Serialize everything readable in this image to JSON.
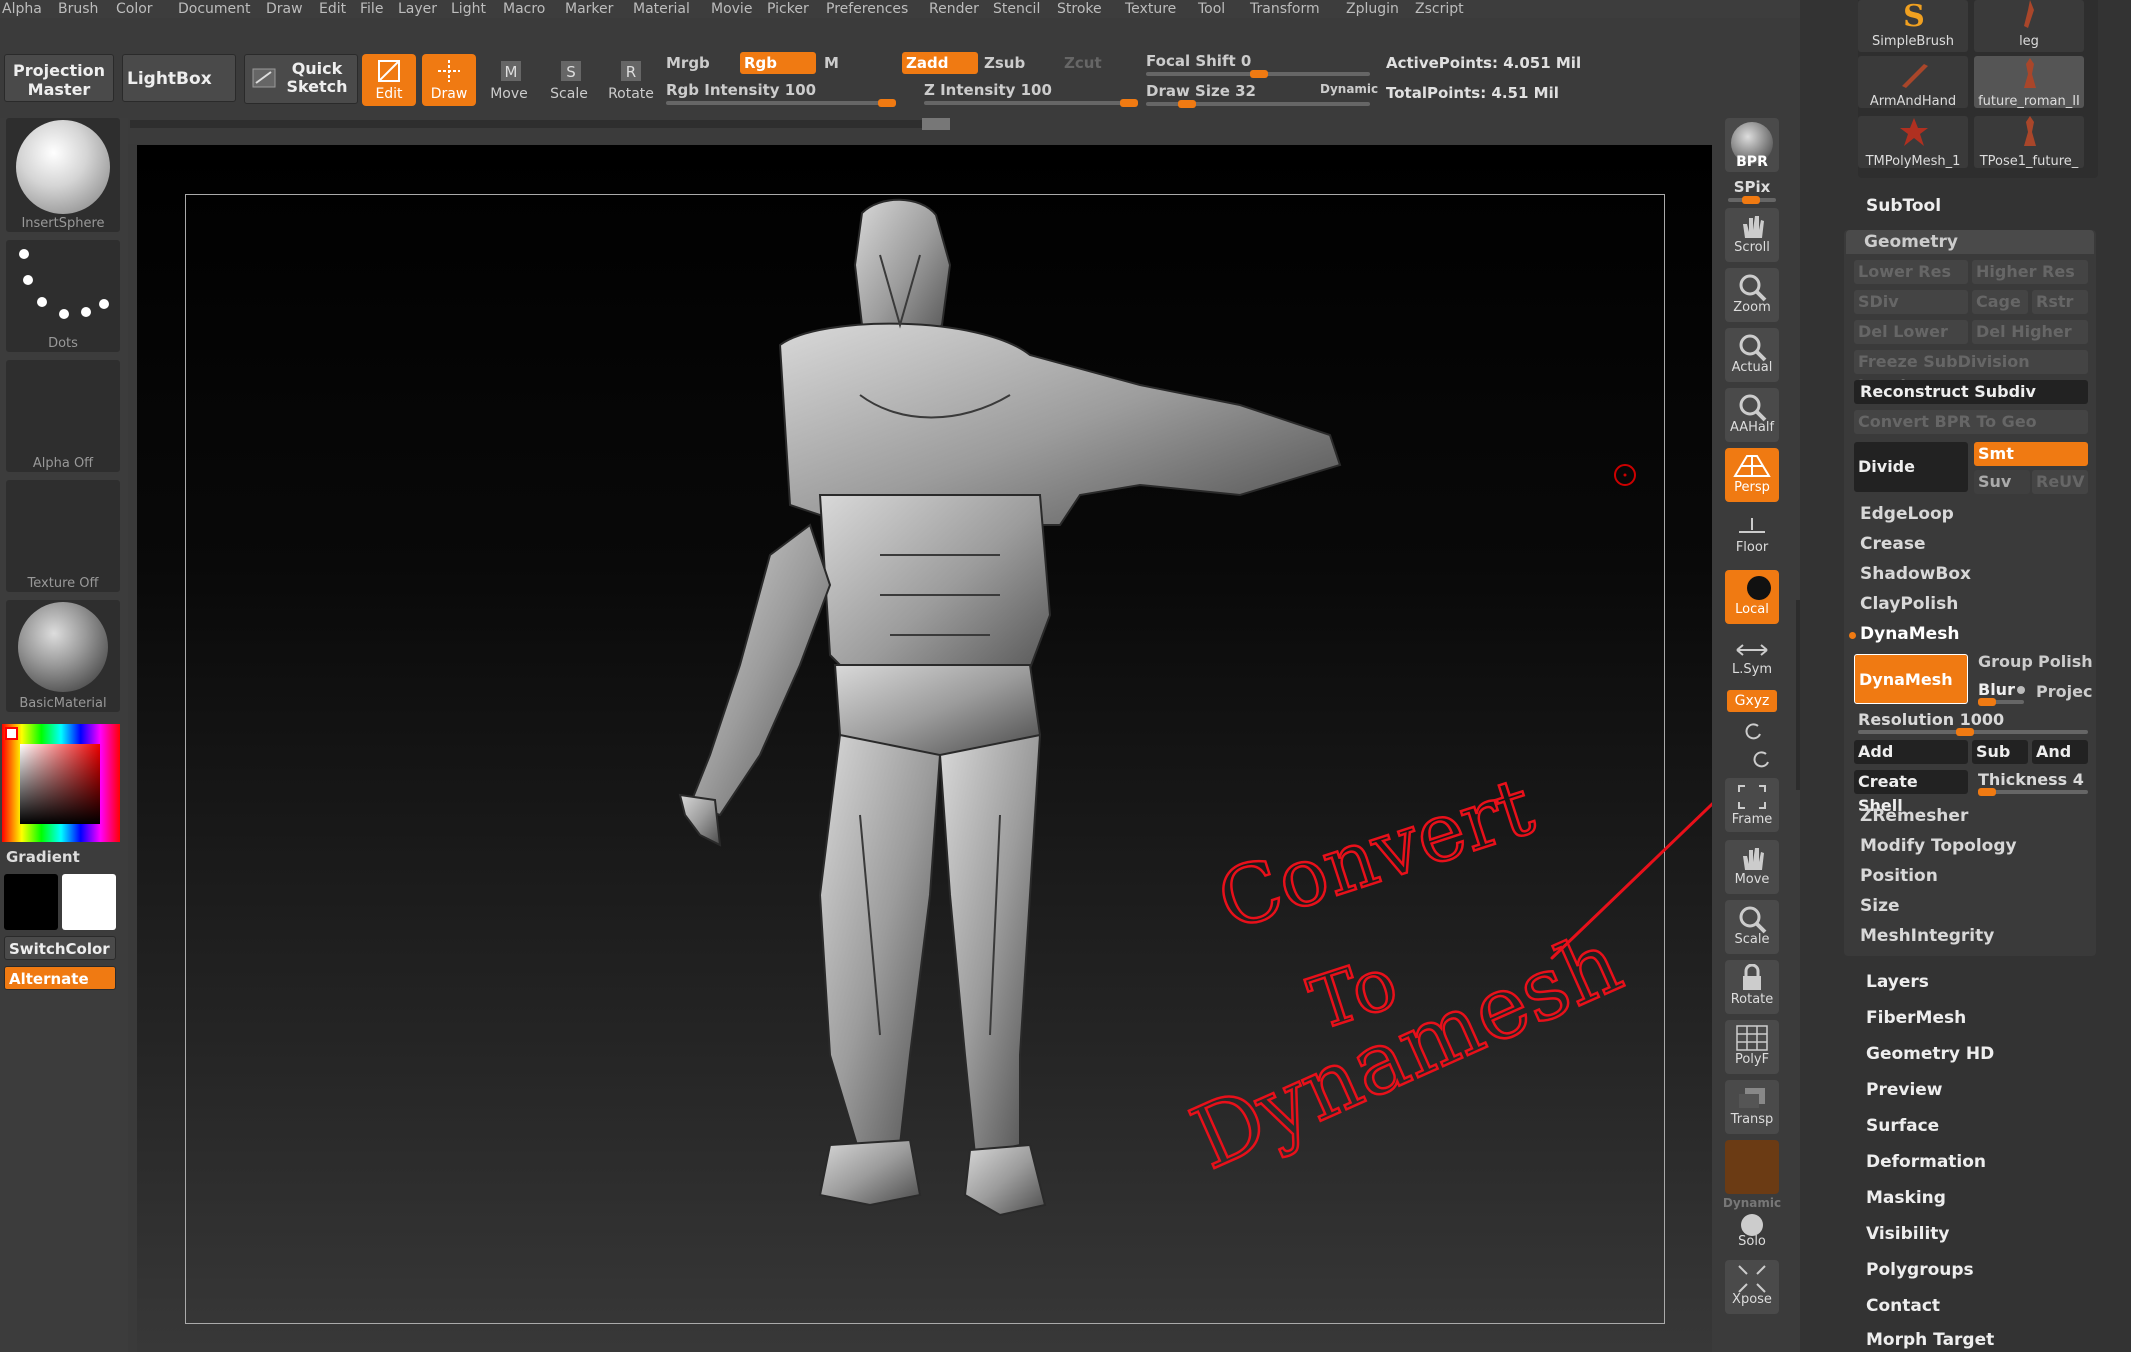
{
  "menu": [
    "Alpha",
    "Brush",
    "Color",
    "Document",
    "Draw",
    "Edit",
    "File",
    "Layer",
    "Light",
    "Macro",
    "Marker",
    "Material",
    "Movie",
    "Picker",
    "Preferences",
    "Render",
    "Stencil",
    "Stroke",
    "Texture",
    "Tool",
    "Transform",
    "Zplugin",
    "Zscript"
  ],
  "top": {
    "projection_master": "Projection Master",
    "lightbox": "LightBox",
    "quick_sketch": "Quick Sketch",
    "edit": "Edit",
    "draw": "Draw",
    "move": "Move",
    "scale": "Scale",
    "rotate": "Rotate",
    "mrgb": "Mrgb",
    "rgb": "Rgb",
    "m": "M",
    "zadd": "Zadd",
    "zsub": "Zsub",
    "zcut": "Zcut",
    "rgb_intensity": "Rgb Intensity 100",
    "z_intensity": "Z Intensity 100",
    "focal_shift": "Focal Shift 0",
    "draw_size": "Draw Size 32",
    "dynamic": "Dynamic",
    "active_points": "ActivePoints: 4.051 Mil",
    "total_points": "TotalPoints: 4.51 Mil"
  },
  "left": {
    "insert_sphere": "InsertSphere",
    "dots": "Dots",
    "alpha_off": "Alpha Off",
    "texture_off": "Texture Off",
    "basic_material": "BasicMaterial",
    "gradient": "Gradient",
    "switch_color": "SwitchColor",
    "alternate": "Alternate"
  },
  "nav": {
    "bpr": "BPR",
    "spix": "SPix",
    "scroll": "Scroll",
    "zoom": "Zoom",
    "actual": "Actual",
    "aahalf": "AAHalf",
    "persp": "Persp",
    "floor": "Floor",
    "local": "Local",
    "lsym": "L.Sym",
    "xyz": "Gxyz",
    "frame": "Frame",
    "move": "Move",
    "scale": "Scale",
    "rotate": "Rotate",
    "polyf": "PolyF",
    "transp": "Transp",
    "dynamic": "Dynamic",
    "solo": "Solo",
    "xpose": "Xpose"
  },
  "brushes": [
    "SimpleBrush",
    "leg",
    "ArmAndHand",
    "future_roman_II",
    "TMPolyMesh_1",
    "TPose1_future_"
  ],
  "tool_panel": {
    "subtool": "SubTool",
    "geometry": "Geometry",
    "lower_res": "Lower Res",
    "higher_res": "Higher Res",
    "sdiv": "SDiv",
    "cage": "Cage",
    "rstr": "Rstr",
    "del_lower": "Del Lower",
    "del_higher": "Del Higher",
    "freeze": "Freeze SubDivision Levels",
    "reconstruct": "Reconstruct Subdiv",
    "convert_bpr": "Convert BPR To Geo",
    "divide": "Divide",
    "smt": "Smt",
    "suv": "Suv",
    "reuv": "ReUV",
    "edgeloop": "EdgeLoop",
    "crease": "Crease",
    "shadowbox": "ShadowBox",
    "claypolish": "ClayPolish",
    "dynamesh_header": "DynaMesh",
    "dynamesh_btn": "DynaMesh",
    "group": "Group",
    "polish": "Polish",
    "blur": "Blur",
    "project": "Projec",
    "resolution": "Resolution 1000",
    "add": "Add",
    "sub": "Sub",
    "and": "And",
    "create_shell": "Create Shell",
    "thickness": "Thickness 4",
    "zremesher": "ZRemesher",
    "modify_topology": "Modify Topology",
    "position": "Position",
    "size": "Size",
    "meshintegrity": "MeshIntegrity",
    "sections": [
      "Layers",
      "FiberMesh",
      "Geometry HD",
      "Preview",
      "Surface",
      "Deformation",
      "Masking",
      "Visibility",
      "Polygroups",
      "Contact",
      "Morph Target"
    ]
  },
  "annotation": {
    "text_lines": [
      "Convert",
      "To",
      "Dynamesh"
    ],
    "color": "#e8101a"
  },
  "colors": {
    "accent": "#f07a12"
  }
}
